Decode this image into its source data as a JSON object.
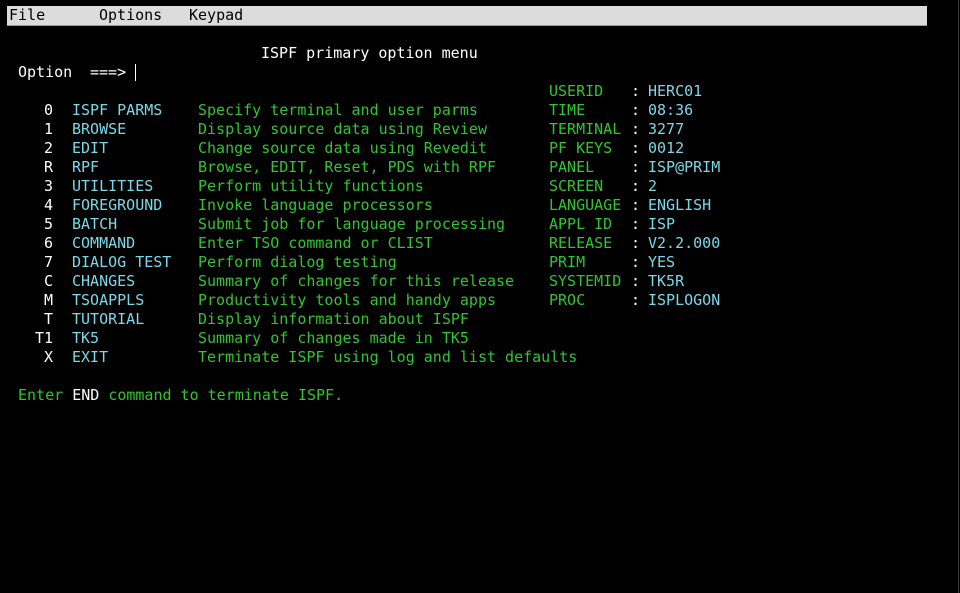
{
  "menu": {
    "items": [
      {
        "label": "File"
      },
      {
        "label": "Options"
      },
      {
        "label": "Keypad"
      }
    ]
  },
  "panel": {
    "title": "ISPF primary option menu",
    "option_label": "Option",
    "option_arrow": "===>",
    "option_value": ""
  },
  "options": [
    {
      "key": "0",
      "name": "ISPF PARMS",
      "desc": "Specify terminal and user parms"
    },
    {
      "key": "1",
      "name": "BROWSE",
      "desc": "Display source data using Review"
    },
    {
      "key": "2",
      "name": "EDIT",
      "desc": "Change source data using Revedit"
    },
    {
      "key": "R",
      "name": "RPF",
      "desc": "Browse, EDIT, Reset, PDS with RPF"
    },
    {
      "key": "3",
      "name": "UTILITIES",
      "desc": "Perform utility functions"
    },
    {
      "key": "4",
      "name": "FOREGROUND",
      "desc": "Invoke language processors"
    },
    {
      "key": "5",
      "name": "BATCH",
      "desc": "Submit job for language processing"
    },
    {
      "key": "6",
      "name": "COMMAND",
      "desc": "Enter TSO command or CLIST"
    },
    {
      "key": "7",
      "name": "DIALOG TEST",
      "desc": "Perform dialog testing"
    },
    {
      "key": "C",
      "name": "CHANGES",
      "desc": "Summary of changes for this release"
    },
    {
      "key": "M",
      "name": "TSOAPPLS",
      "desc": "Productivity tools and handy apps"
    },
    {
      "key": "T",
      "name": "TUTORIAL",
      "desc": "Display information about ISPF"
    },
    {
      "key": "T1",
      "name": "TK5",
      "desc": "Summary of changes made in TK5"
    },
    {
      "key": "X",
      "name": "EXIT",
      "desc": "Terminate ISPF using log and list defaults"
    }
  ],
  "info": [
    {
      "label": "USERID",
      "sep": ":",
      "value": "HERC01"
    },
    {
      "label": "TIME",
      "sep": ":",
      "value": "08:36"
    },
    {
      "label": "TERMINAL",
      "sep": ":",
      "value": "3277"
    },
    {
      "label": "PF KEYS",
      "sep": ":",
      "value": "0012"
    },
    {
      "label": "PANEL",
      "sep": ":",
      "value": "ISP@PRIM"
    },
    {
      "label": "SCREEN",
      "sep": ":",
      "value": "2"
    },
    {
      "label": "LANGUAGE",
      "sep": ":",
      "value": "ENGLISH"
    },
    {
      "label": "APPL ID",
      "sep": ":",
      "value": "ISP"
    },
    {
      "label": "RELEASE",
      "sep": ":",
      "value": "V2.2.000"
    },
    {
      "label": "PRIM",
      "sep": ":",
      "value": "YES"
    },
    {
      "label": "SYSTEMID",
      "sep": ":",
      "value": "TK5R"
    },
    {
      "label": "PROC",
      "sep": ":",
      "value": "ISPLOGON"
    }
  ],
  "footer": {
    "prefix": "Enter",
    "keyword": "END",
    "suffix": "command to terminate ISPF."
  },
  "colors": {
    "background": "#000000",
    "field": "#7ad8e8",
    "text": "#2fc52f",
    "highlight": "#ffffff",
    "menubar": "#dcdcdc"
  }
}
